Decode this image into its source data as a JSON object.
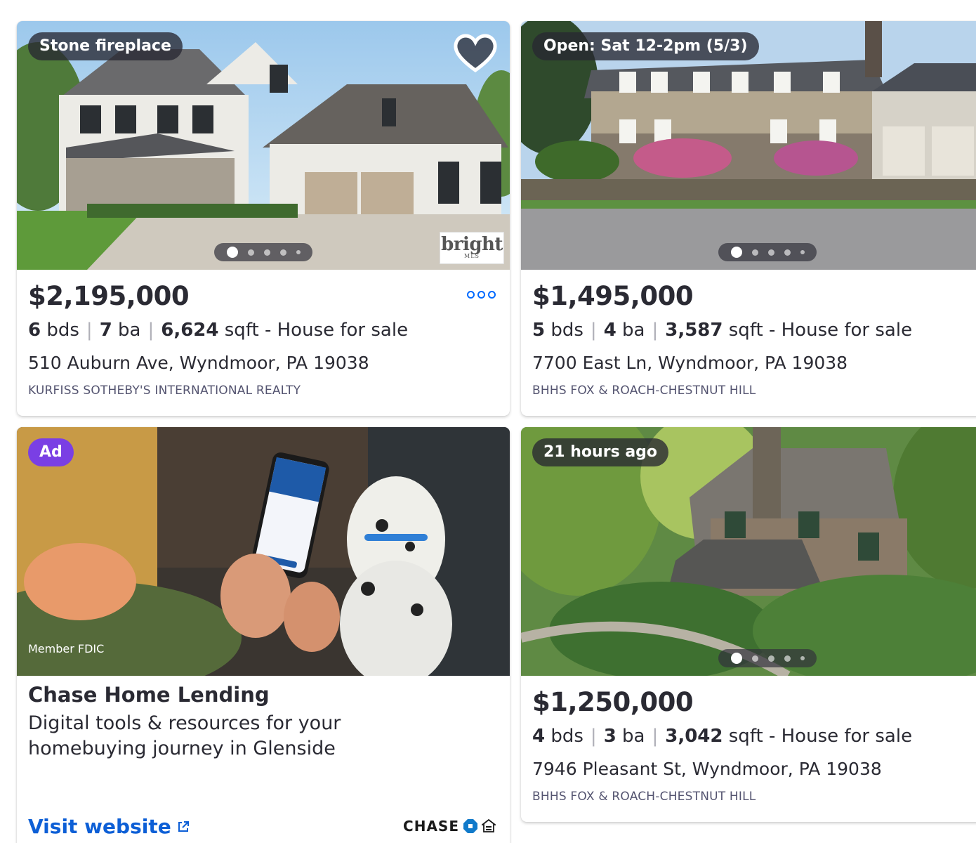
{
  "listings": [
    {
      "badge": "Stone fireplace",
      "price": "$2,195,000",
      "beds": "6",
      "beds_unit": "bds",
      "baths": "7",
      "baths_unit": "ba",
      "sqft": "6,624",
      "sqft_unit": "sqft",
      "type": "- House for sale",
      "address": "510 Auburn Ave, Wyndmoor, PA 19038",
      "broker": "KURFISS SOTHEBY'S INTERNATIONAL REALTY"
    },
    {
      "badge": "Open: Sat 12-2pm (5/3)",
      "price": "$1,495,000",
      "beds": "5",
      "beds_unit": "bds",
      "baths": "4",
      "baths_unit": "ba",
      "sqft": "3,587",
      "sqft_unit": "sqft",
      "type": "- House for sale",
      "address": "7700 East Ln, Wyndmoor, PA 19038",
      "broker": "BHHS FOX & ROACH-CHESTNUT HILL"
    },
    {
      "badge": "21 hours ago",
      "price": "$1,250,000",
      "beds": "4",
      "beds_unit": "bds",
      "baths": "3",
      "baths_unit": "ba",
      "sqft": "3,042",
      "sqft_unit": "sqft",
      "type": "- House for sale",
      "address": "7946 Pleasant St, Wyndmoor, PA 19038",
      "broker": "BHHS FOX & ROACH-CHESTNUT HILL"
    }
  ],
  "mls_logo": {
    "text": "bright",
    "sub": "MLS"
  },
  "ad": {
    "badge": "Ad",
    "fdic": "Member FDIC",
    "title": "Chase Home Lending",
    "description": "Digital tools & resources for your homebuying journey in Glenside",
    "cta": "Visit website",
    "brand": "CHASE"
  },
  "colors": {
    "accent": "#006aff",
    "link": "#0d5fd6",
    "ad_badge": "#7a3fe4",
    "text": "#2a2a33",
    "muted": "#545470"
  },
  "icons": {
    "favorite": "heart-icon",
    "more": "more-options-icon",
    "external": "external-link-icon"
  }
}
